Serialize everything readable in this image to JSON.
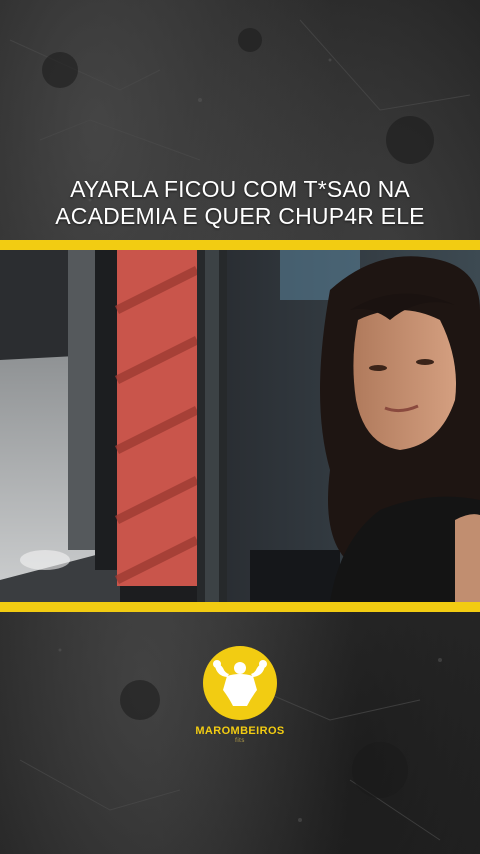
{
  "caption": {
    "line1": "AYARLA FICOU COM T*SA0 NA",
    "line2": "ACADEMIA E QUER CHUP4R ELE"
  },
  "logo": {
    "name": "MAROMBEIROS",
    "sub": "fits",
    "icon": "flexing-bodybuilder-icon"
  },
  "colors": {
    "accent": "#f2cc12",
    "background": "#2f2f2f",
    "caption_text": "#ffffff"
  }
}
